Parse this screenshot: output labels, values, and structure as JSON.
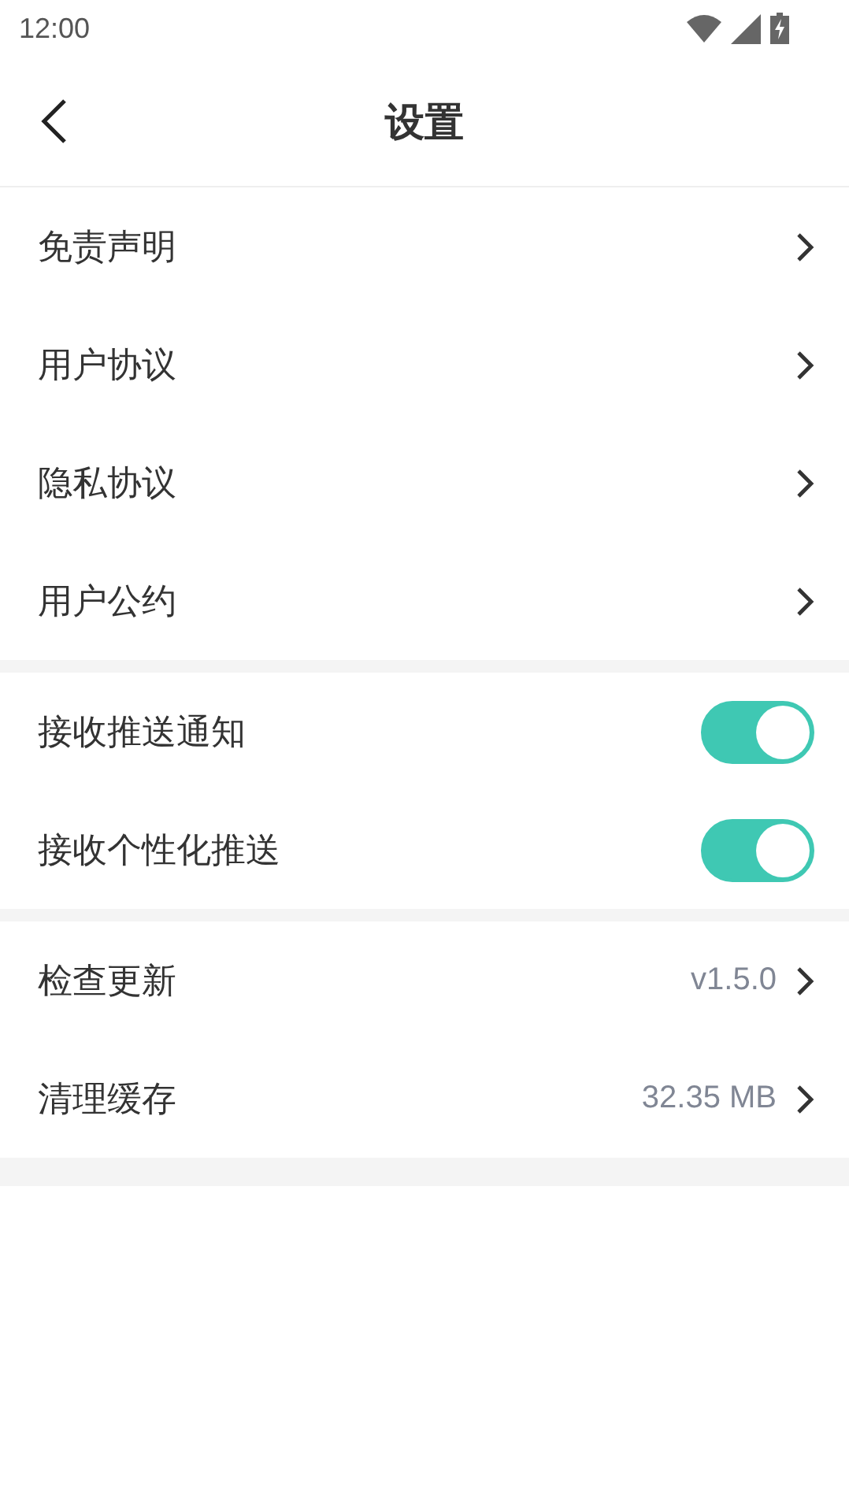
{
  "status_bar": {
    "time": "12:00"
  },
  "header": {
    "title": "设置"
  },
  "sections": [
    {
      "items": [
        {
          "kind": "link",
          "label": "免责声明"
        },
        {
          "kind": "link",
          "label": "用户协议"
        },
        {
          "kind": "link",
          "label": "隐私协议"
        },
        {
          "kind": "link",
          "label": "用户公约"
        }
      ]
    },
    {
      "items": [
        {
          "kind": "toggle",
          "label": "接收推送通知",
          "on": true
        },
        {
          "kind": "toggle",
          "label": "接收个性化推送",
          "on": true
        }
      ]
    },
    {
      "items": [
        {
          "kind": "link",
          "label": "检查更新",
          "value": "v1.5.0"
        },
        {
          "kind": "link",
          "label": "清理缓存",
          "value": "32.35 MB"
        }
      ]
    }
  ]
}
